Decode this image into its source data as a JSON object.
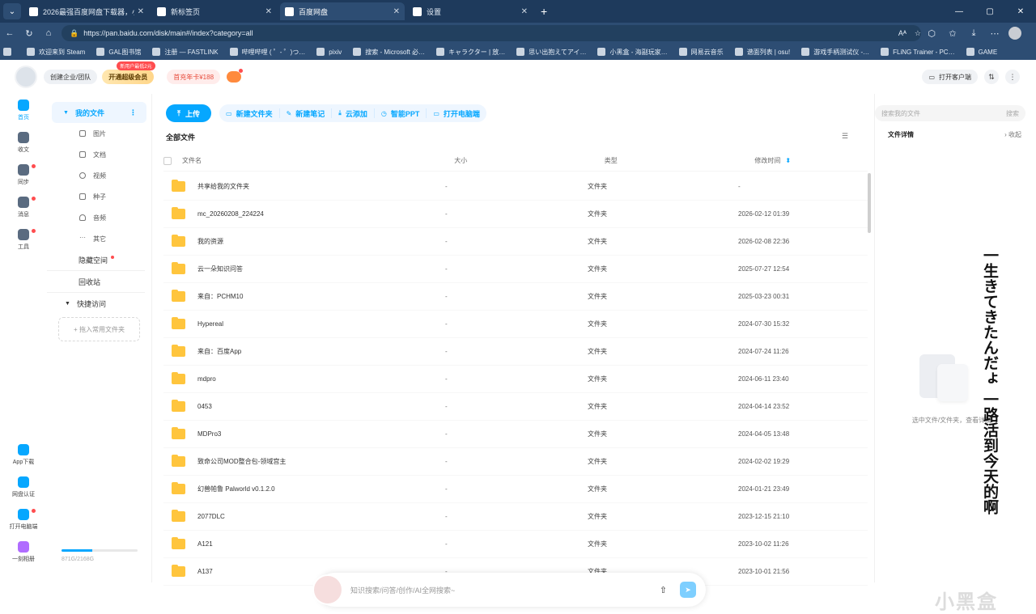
{
  "browser": {
    "tabs": [
      {
        "label": "2026最强百度网盘下载器，小白式…",
        "active": false
      },
      {
        "label": "新标签页",
        "active": false
      },
      {
        "label": "百度网盘",
        "active": true
      },
      {
        "label": "设置",
        "active": false
      }
    ],
    "url": "https://pan.baidu.com/disk/main#/index?category=all",
    "bookmarks": [
      "欢迎来到 Steam",
      "GAL图书馆",
      "注册 — FASTLINK",
      "哔哩哔哩 ( ゜- ゜)つ…",
      "pixiv",
      "搜索 - Microsoft 必…",
      "キャラクター | 放…",
      "思い出抱えてアイ…",
      "小黑盒 - 海副玩家…",
      "网易云音乐",
      "谱面列表 | osu!",
      "游戏手柄测试仪 -…",
      "FLiNG Trainer - PC…",
      "GAME"
    ]
  },
  "header": {
    "team_label": "创建企业/团队",
    "vip_label": "开通超级会员",
    "vip_tag": "新用户最低2元",
    "promo_label": "首充年卡¥188",
    "client_label": "打开客户端"
  },
  "rail": {
    "items": [
      {
        "label": "首页",
        "active": true,
        "dot": false
      },
      {
        "label": "收文",
        "active": false,
        "dot": false
      },
      {
        "label": "同步",
        "active": false,
        "dot": true
      },
      {
        "label": "消息",
        "active": false,
        "dot": true
      },
      {
        "label": "工具",
        "active": false,
        "dot": true
      }
    ],
    "bottom": [
      {
        "label": "App下载",
        "dot": false
      },
      {
        "label": "网盘认证",
        "dot": false
      },
      {
        "label": "打开电脑端",
        "dot": true
      },
      {
        "label": "一刻相册",
        "dot": false
      }
    ]
  },
  "sidebar": {
    "my_files": "我的文件",
    "more": "⋮",
    "categories": [
      "图片",
      "文档",
      "视频",
      "种子",
      "音频",
      "其它"
    ],
    "hidden_space": "隐藏空间",
    "recycle": "回收站",
    "quick_access": "快捷访问",
    "add_folder": "+ 拖入常用文件夹",
    "quota_text": "871G/2168G",
    "quota_fraction": 0.4
  },
  "toolbar": {
    "upload": "上传",
    "new_folder": "新建文件夹",
    "new_note": "新建笔记",
    "cloud_add": "云添加",
    "smart_ppt": "智能PPT",
    "open_pc": "打开电脑端"
  },
  "crumb": "全部文件",
  "columns": {
    "name": "文件名",
    "size": "大小",
    "type": "类型",
    "time": "修改时间"
  },
  "files": [
    {
      "name": "共享给我的文件夹",
      "size": "-",
      "type": "文件夹",
      "time": "-"
    },
    {
      "name": "mc_20260208_224224",
      "size": "-",
      "type": "文件夹",
      "time": "2026-02-12 01:39"
    },
    {
      "name": "我的资源",
      "size": "-",
      "type": "文件夹",
      "time": "2026-02-08 22:36"
    },
    {
      "name": "云一朵知识问答",
      "size": "-",
      "type": "文件夹",
      "time": "2025-07-27 12:54"
    },
    {
      "name": "来自：PCHM10",
      "size": "-",
      "type": "文件夹",
      "time": "2025-03-23 00:31"
    },
    {
      "name": "Hypereal",
      "size": "-",
      "type": "文件夹",
      "time": "2024-07-30 15:32"
    },
    {
      "name": "来自：百度App",
      "size": "-",
      "type": "文件夹",
      "time": "2024-07-24 11:26"
    },
    {
      "name": "mdpro",
      "size": "-",
      "type": "文件夹",
      "time": "2024-06-11 23:40"
    },
    {
      "name": "0453",
      "size": "-",
      "type": "文件夹",
      "time": "2024-04-14 23:52"
    },
    {
      "name": "MDPro3",
      "size": "-",
      "type": "文件夹",
      "time": "2024-04-05 13:48"
    },
    {
      "name": "致命公司MOD整合包-领域宫主",
      "size": "-",
      "type": "文件夹",
      "time": "2024-02-02 19:29"
    },
    {
      "name": "幻兽帕鲁 Palworld v0.1.2.0",
      "size": "-",
      "type": "文件夹",
      "time": "2024-01-21 23:49"
    },
    {
      "name": "2077DLC",
      "size": "-",
      "type": "文件夹",
      "time": "2023-12-15 21:10"
    },
    {
      "name": "A121",
      "size": "-",
      "type": "文件夹",
      "time": "2023-10-02 11:26"
    },
    {
      "name": "A137",
      "size": "-",
      "type": "文件夹",
      "time": "2023-10-01 21:56"
    }
  ],
  "ai": {
    "placeholder": "知识搜索/问答/创作/AI全网搜索~"
  },
  "right": {
    "search_placeholder": "搜索我的文件",
    "search_btn": "搜索",
    "detail_title": "文件详情",
    "collapse": "收起",
    "empty": "选中文件/文件夹，查看详情"
  },
  "overlay_text": "一生きてきたんだょ 一路活到今天的啊",
  "watermark": "小黑盒",
  "colors": {
    "accent": "#06a7ff",
    "chrome": "#2d4d73",
    "folder": "#ffc53d"
  }
}
